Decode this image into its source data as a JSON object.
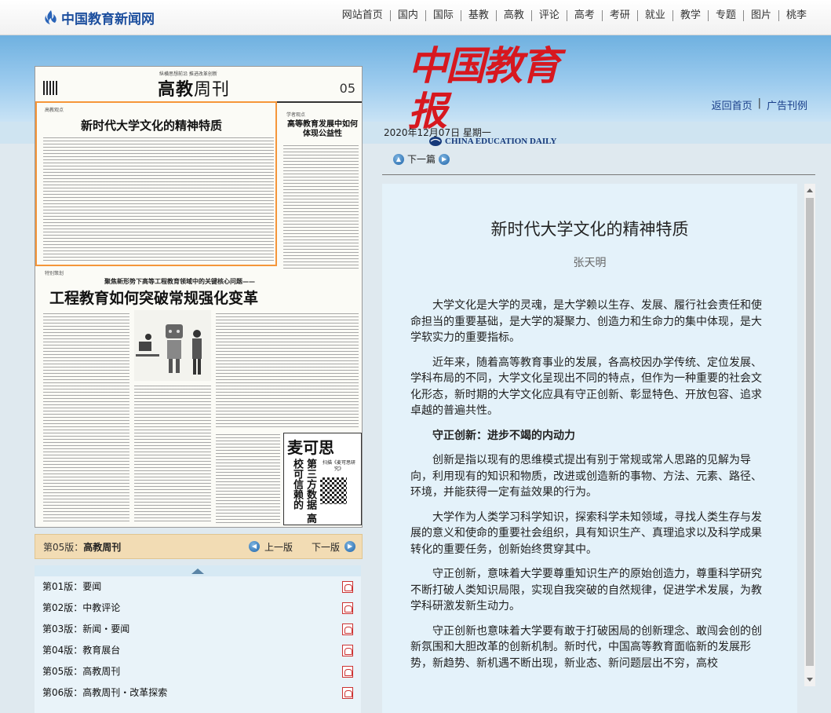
{
  "site": {
    "logo_text": "中国教育新闻网",
    "nav": [
      "网站首页",
      "国内",
      "国际",
      "基教",
      "高教",
      "评论",
      "高考",
      "考研",
      "就业",
      "教学",
      "专题",
      "图片",
      "桃李"
    ]
  },
  "header": {
    "masthead": "中国教育报",
    "masthead_en": "CHINA EDUCATION DAILY",
    "links": [
      "返回首页",
      "广告刊例"
    ],
    "date": "2020年12月07日 星期一"
  },
  "paper": {
    "slogan": "纵横思想前沿 推进改革创新",
    "title_bold": "高教",
    "title_light": "周刊",
    "page_no": "05",
    "tag1": "高教观点",
    "head1": "新时代大学文化的精神特质",
    "tag_side": "学者观点",
    "side_head": "高等教育发展中如何体现公益性",
    "tag2": "特别策划",
    "pre2": "聚焦新形势下高等工程教育领域中的关键核心问题——",
    "head2": "工程教育如何突破常规强化变革",
    "ad_title": "麦可思",
    "ad_vertical": "第三方数据 高校可信赖的",
    "ad_text": "扫描《麦可思研究》"
  },
  "pagebar": {
    "current_label": "第05版：",
    "current_name": "高教周刊",
    "prev": "上一版",
    "next": "下一版"
  },
  "pagelist": [
    {
      "label": "第01版：",
      "name": "要闻"
    },
    {
      "label": "第02版：",
      "name": "中教评论"
    },
    {
      "label": "第03版：",
      "name": "新闻・要闻"
    },
    {
      "label": "第04版：",
      "name": "教育展台"
    },
    {
      "label": "第05版：",
      "name": "高教周刊"
    },
    {
      "label": "第06版：",
      "name": "高教周刊・改革探索"
    }
  ],
  "article": {
    "nav_next": "下一篇",
    "title": "新时代大学文化的精神特质",
    "author": "张天明",
    "paragraphs": [
      "大学文化是大学的灵魂，是大学赖以生存、发展、履行社会责任和使命担当的重要基础，是大学的凝聚力、创造力和生命力的集中体现，是大学软实力的重要指标。",
      "近年来，随着高等教育事业的发展，各高校因办学传统、定位发展、学科布局的不同，大学文化呈现出不同的特点，但作为一种重要的社会文化形态，新时期的大学文化应具有守正创新、彰显特色、开放包容、追求卓越的普遍共性。",
      "守正创新：进步不竭的内动力",
      "创新是指以现有的思维模式提出有别于常规或常人思路的见解为导向，利用现有的知识和物质，改进或创造新的事物、方法、元素、路径、环境，并能获得一定有益效果的行为。",
      "大学作为人类学习科学知识，探索科学未知领域，寻找人类生存与发展的意义和使命的重要社会组织，具有知识生产、真理追求以及科学成果转化的重要任务，创新始终贯穿其中。",
      "守正创新，意味着大学要尊重知识生产的原始创造力，尊重科学研究不断打破人类知识局限，实现自我突破的自然规律，促进学术发展，为教学科研激发新生动力。",
      "守正创新也意味着大学要有敢于打破困局的创新理念、敢闯会创的创新氛围和大胆改革的创新机制。新时代，中国高等教育面临新的发展形势，新趋势、新机遇不断出现，新业态、新问题层出不穷，高校"
    ]
  },
  "colors": {
    "accent": "#f5963a",
    "masthead": "#d7181f",
    "link": "#1a3f8a"
  }
}
